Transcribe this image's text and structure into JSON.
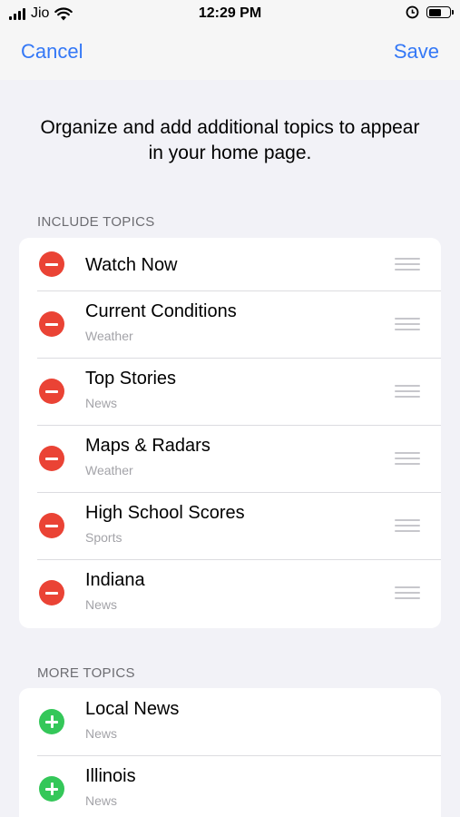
{
  "status_bar": {
    "carrier": "Jio",
    "time": "12:29 PM",
    "icons": [
      "signal-bars-icon",
      "wifi-icon",
      "location-lock-icon",
      "battery-icon"
    ]
  },
  "nav": {
    "cancel_label": "Cancel",
    "save_label": "Save"
  },
  "intro_text": "Organize and add additional topics to appear in your home page.",
  "include": {
    "header": "INCLUDE TOPICS",
    "items": [
      {
        "title": "Watch Now",
        "subtitle": ""
      },
      {
        "title": "Current Conditions",
        "subtitle": "Weather"
      },
      {
        "title": "Top Stories",
        "subtitle": "News"
      },
      {
        "title": "Maps & Radars",
        "subtitle": "Weather"
      },
      {
        "title": "High School Scores",
        "subtitle": "Sports"
      },
      {
        "title": "Indiana",
        "subtitle": "News"
      }
    ]
  },
  "more": {
    "header": "MORE TOPICS",
    "items": [
      {
        "title": "Local News",
        "subtitle": "News"
      },
      {
        "title": "Illinois",
        "subtitle": "News"
      }
    ]
  },
  "colors": {
    "accent": "#3478f6",
    "remove": "#ea4335",
    "add": "#34c759",
    "background": "#f2f2f7"
  }
}
